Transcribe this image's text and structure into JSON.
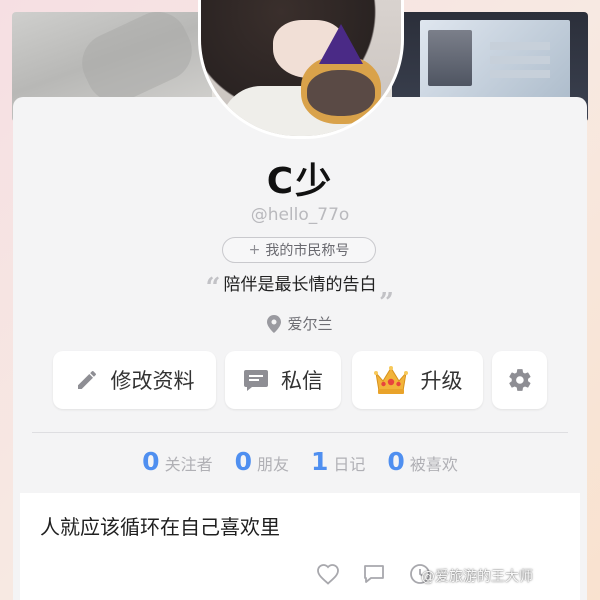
{
  "profile": {
    "name": "C少",
    "handle": "@hello_77o",
    "citizen_tag": "我的市民称号",
    "bio": "陪伴是最长情的告白",
    "location": "爱尔兰"
  },
  "actions": {
    "edit_label": "修改资料",
    "message_label": "私信",
    "upgrade_label": "升级"
  },
  "stats": [
    {
      "value": "0",
      "label": "关注者"
    },
    {
      "value": "0",
      "label": "朋友"
    },
    {
      "value": "1",
      "label": "日记"
    },
    {
      "value": "0",
      "label": "被喜欢"
    }
  ],
  "post": {
    "text": "人就应该循环在自己喜欢里"
  },
  "watermark": "@爱旅游的王大师",
  "colors": {
    "accent": "#4f8ff0",
    "card_bg": "#f4f4f5",
    "crown_gold": "#f2b33a"
  },
  "icons": [
    "pencil-icon",
    "message-bubble-icon",
    "crown-icon",
    "gear-icon",
    "location-pin-icon",
    "heart-icon",
    "comment-icon",
    "clock-icon",
    "plus-icon"
  ]
}
